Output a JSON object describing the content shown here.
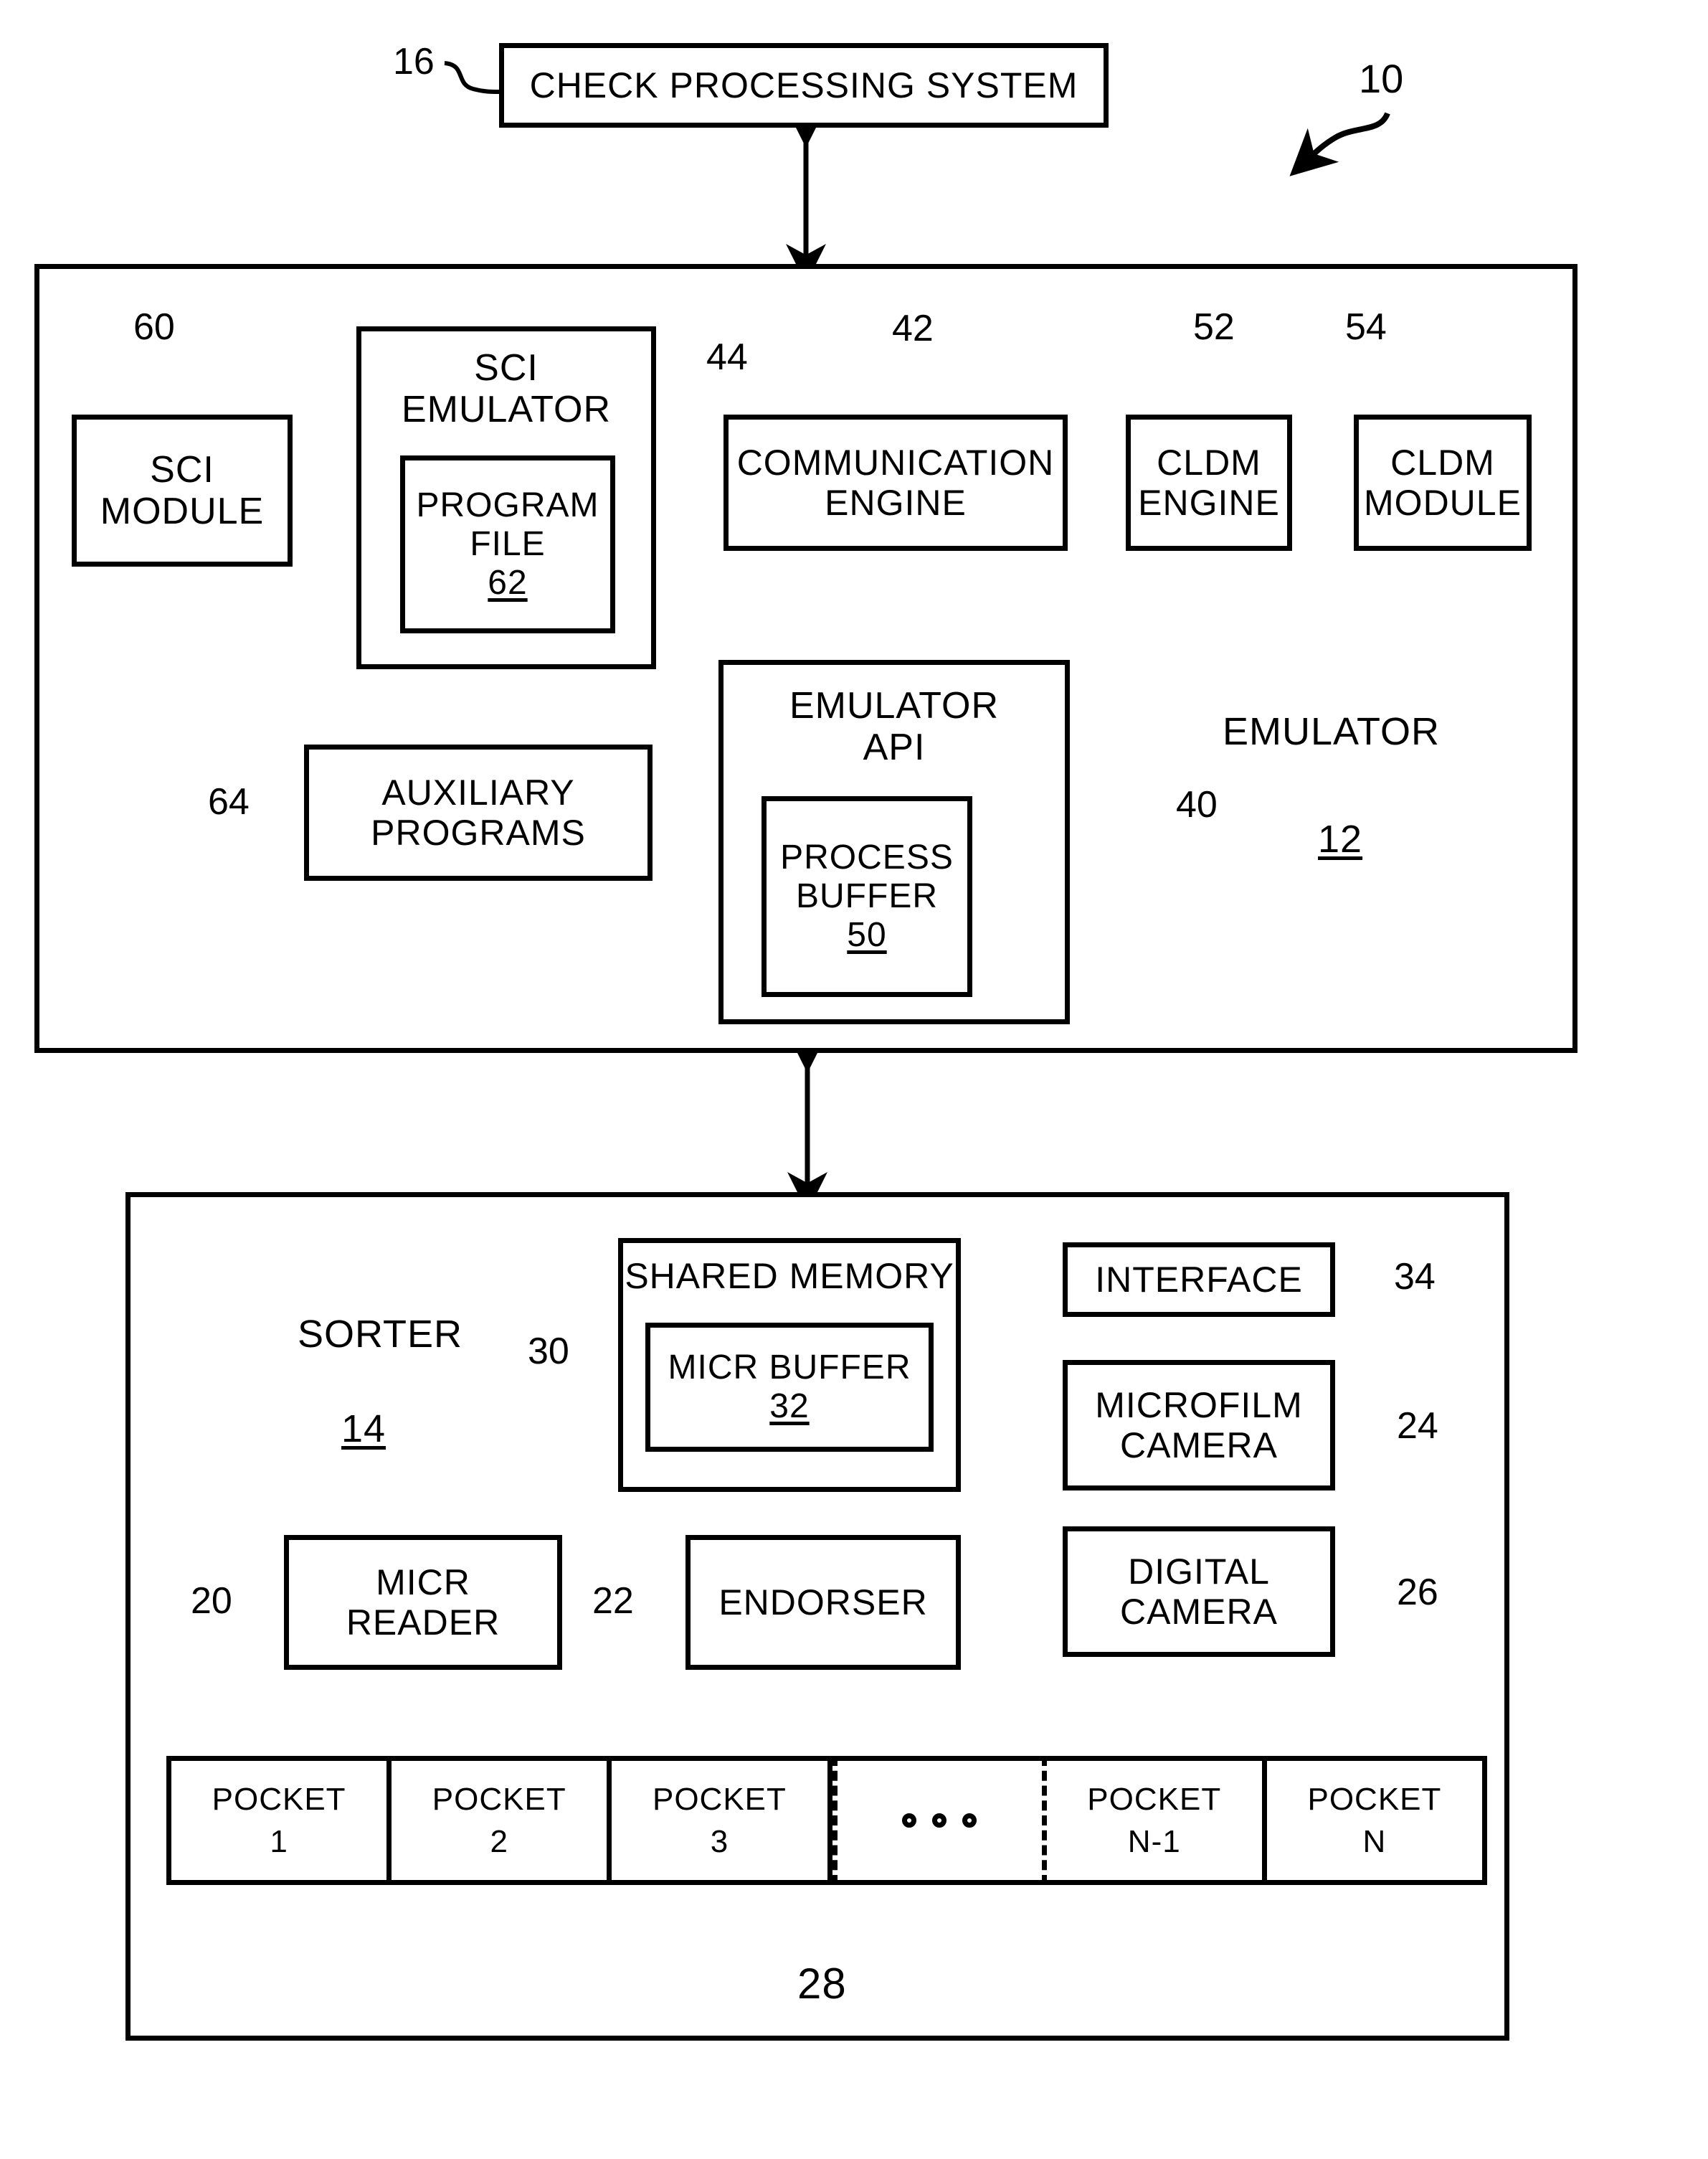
{
  "figure": {
    "system_ref": "10",
    "check_processing_system": {
      "label": "CHECK PROCESSING SYSTEM",
      "ref": "16"
    },
    "emulator": {
      "title": "EMULATOR",
      "ref": "12",
      "sci_module": {
        "line1": "SCI",
        "line2": "MODULE",
        "ref": "60"
      },
      "sci_emulator": {
        "line1": "SCI",
        "line2": "EMULATOR",
        "ref": "44",
        "program_file": {
          "line1": "PROGRAM",
          "line2": "FILE",
          "ref": "62"
        }
      },
      "auxiliary_programs": {
        "line1": "AUXILIARY",
        "line2": "PROGRAMS",
        "ref": "64"
      },
      "communication_engine": {
        "line1": "COMMUNICATION",
        "line2": "ENGINE",
        "ref": "42"
      },
      "cldm_engine": {
        "line1": "CLDM",
        "line2": "ENGINE",
        "ref": "52"
      },
      "cldm_module": {
        "line1": "CLDM",
        "line2": "MODULE",
        "ref": "54"
      },
      "emulator_api": {
        "line1": "EMULATOR",
        "line2": "API",
        "ref": "40",
        "process_buffer": {
          "line1": "PROCESS",
          "line2": "BUFFER",
          "ref": "50"
        }
      }
    },
    "sorter": {
      "title": "SORTER",
      "ref": "14",
      "shared_memory": {
        "label": "SHARED MEMORY",
        "ref": "30",
        "micr_buffer": {
          "label": "MICR BUFFER",
          "ref": "32"
        }
      },
      "interface": {
        "label": "INTERFACE",
        "ref": "34"
      },
      "microfilm_camera": {
        "line1": "MICROFILM",
        "line2": "CAMERA",
        "ref": "24"
      },
      "digital_camera": {
        "line1": "DIGITAL",
        "line2": "CAMERA",
        "ref": "26"
      },
      "micr_reader": {
        "line1": "MICR",
        "line2": "READER",
        "ref": "20"
      },
      "endorser": {
        "label": "ENDORSER",
        "ref": "22"
      },
      "pockets": {
        "brace_ref": "28",
        "items": [
          {
            "line1": "POCKET",
            "line2": "1"
          },
          {
            "line1": "POCKET",
            "line2": "2"
          },
          {
            "line1": "POCKET",
            "line2": "3"
          },
          {
            "line1": "",
            "line2": ""
          },
          {
            "line1": "POCKET",
            "line2": "N-1"
          },
          {
            "line1": "POCKET",
            "line2": "N"
          }
        ]
      }
    }
  }
}
